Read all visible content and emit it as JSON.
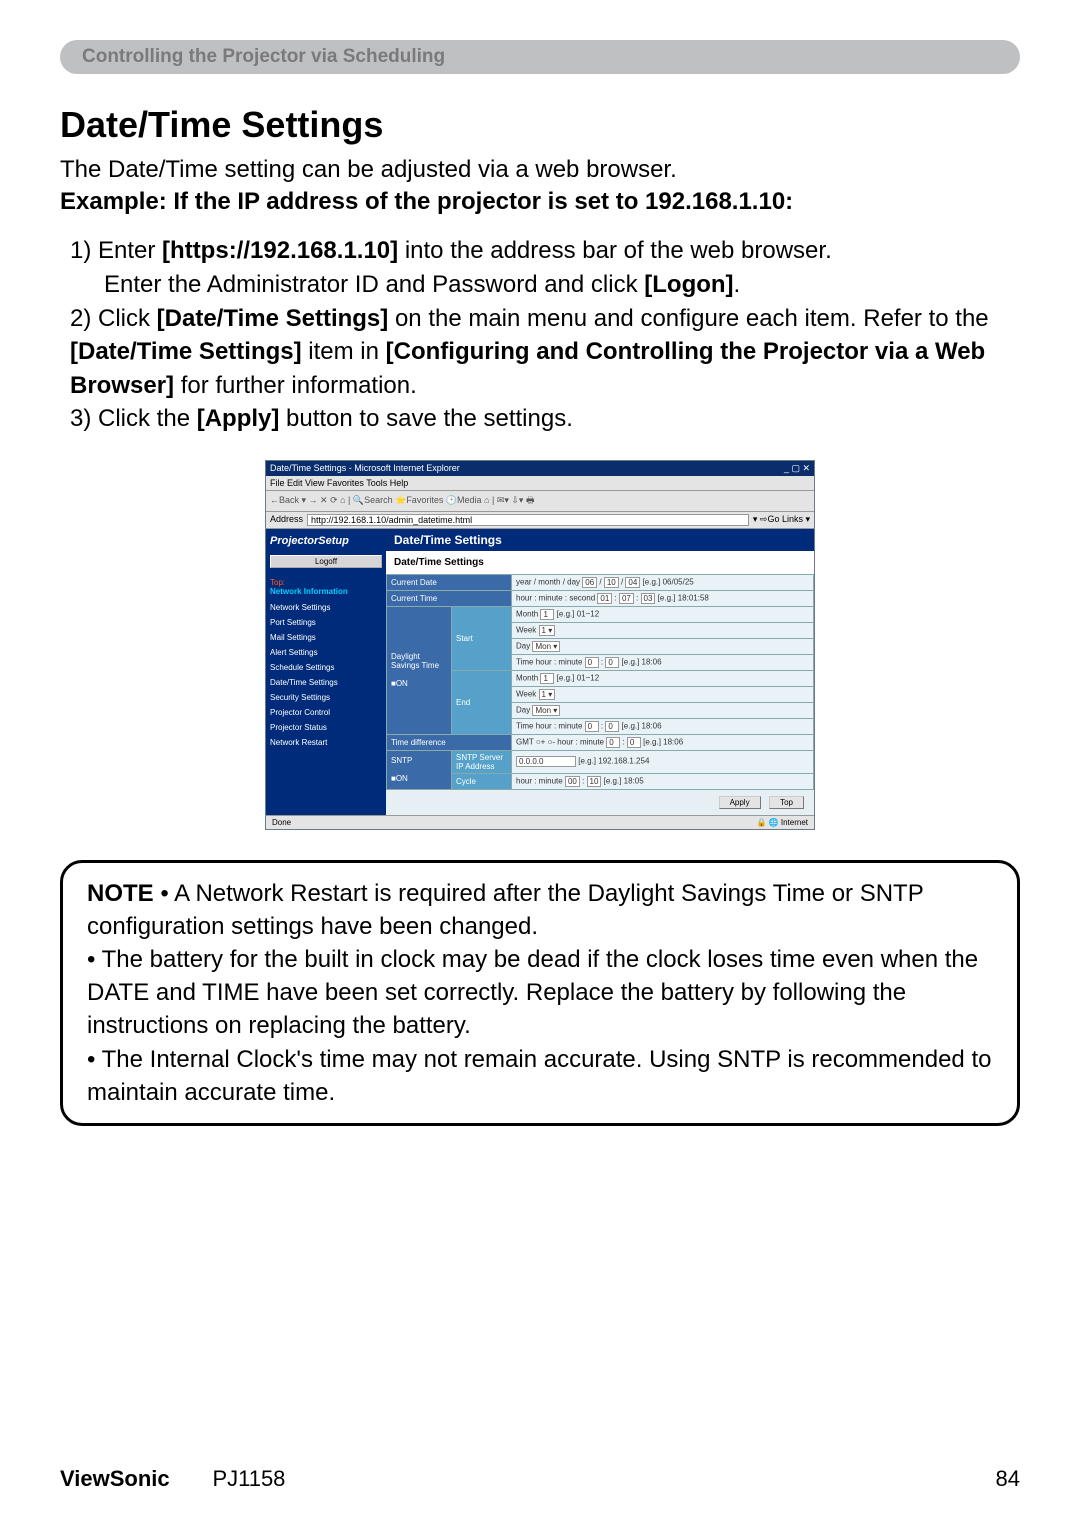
{
  "section_header": "Controlling the Projector via Scheduling",
  "page_title": "Date/Time Settings",
  "intro": "The Date/Time setting can be adjusted via a web browser.",
  "example_label": "Example: If the IP address of the projector is set to 192.168.1.10:",
  "steps": {
    "s1a": "1) Enter ",
    "s1b": "[https://192.168.1.10]",
    "s1c": " into the address bar of the web browser.",
    "s1d": "Enter the Administrator ID and Password and click ",
    "s1e": "[Logon]",
    "s1f": ".",
    "s2a": "2) Click ",
    "s2b": "[Date/Time Settings]",
    "s2c": " on the main menu and configure each item. Refer to the ",
    "s2d": "[Date/Time Settings]",
    "s2e": " item in ",
    "s2f": "[Configuring and Controlling the Projector via a Web Browser]",
    "s2g": " for further information.",
    "s3a": "3) Click the ",
    "s3b": "[Apply]",
    "s3c": " button to save the settings."
  },
  "shot": {
    "ie_title": "Date/Time Settings - Microsoft Internet Explorer",
    "ie_menu": "File  Edit  View  Favorites  Tools  Help",
    "ie_toolbar": "←Back ▾  →  ✕  ⟳  ⌂  | 🔍Search  ⭐Favorites  🕑Media  ⌂ | ✉▾ ⇩▾ 🖶",
    "addr_label": "Address",
    "addr_value": "http://192.168.1.10/admin_datetime.html",
    "go_label": "▾ ⇨Go  Links ▾",
    "setup_logo": "ProjectorSetup",
    "logoff": "Logoff",
    "side_top": "Top:",
    "side_net_info": "Network Information",
    "side_items": [
      "Network Settings",
      "Port Settings",
      "Mail Settings",
      "Alert Settings",
      "Schedule Settings",
      "Date/Time Settings",
      "Security Settings",
      "Projector Control",
      "Projector Status",
      "Network Restart"
    ],
    "main_header": "Date/Time Settings",
    "sub_header": "Date/Time Settings",
    "rows": {
      "current_date": "Current Date",
      "current_date_val_prefix": "year / month / day",
      "current_date_eg": "[e.g.] 06/05/25",
      "current_time": "Current Time",
      "current_time_val_prefix": "hour : minute : second",
      "current_time_eg": "[e.g.] 18:01:58",
      "dst": "Daylight Savings Time",
      "on_chk": "■ON",
      "start": "Start",
      "end": "End",
      "month": "Month",
      "month_eg": "[e.g.] 01~12",
      "week": "Week",
      "day": "Day",
      "time_label": "Time hour : minute",
      "time_eg": "[e.g.] 18:06",
      "time_diff": "Time difference",
      "gmt": "GMT  ○+  ○-    hour : minute",
      "gmt_eg": "[e.g.] 18:06",
      "sntp": "SNTP",
      "sntp_server": "SNTP Server IP Address",
      "sntp_val": "0.0.0.0",
      "sntp_eg": "[e.g.] 192.168.1.254",
      "cycle": "Cycle",
      "cycle_prefix": "hour : minute",
      "cycle_eg": "[e.g.] 18:05"
    },
    "apply_btn": "Apply",
    "top_btn": "Top",
    "status_done": "Done",
    "status_net": "🔒 🌐 Internet"
  },
  "note": {
    "lead": "NOTE",
    "bullet1a": "  • A Network Restart is required after the Daylight Savings Time or SNTP configuration settings have been changed.",
    "bullet2": "• The battery for the built in clock may be dead if the clock loses time even when the DATE and TIME have been set correctly. Replace the battery by following the instructions on replacing the battery.",
    "bullet3": "• The Internal Clock's time may not remain accurate. Using SNTP is recommended to maintain accurate time."
  },
  "footer": {
    "brand": "ViewSonic",
    "model": "PJ1158",
    "page": "84"
  }
}
